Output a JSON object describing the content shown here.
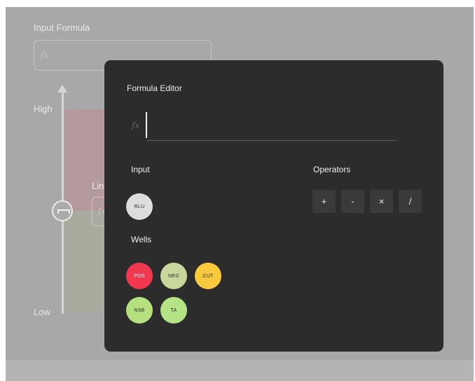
{
  "background": {
    "input_formula_label": "Input Formula",
    "fx_placeholder": "fx",
    "high_label": "High",
    "low_label": "Low",
    "partial_label": "Lin",
    "mini_fx": "fx"
  },
  "modal": {
    "title": "Formula Editor",
    "fx_label": "fx",
    "formula_value": "",
    "input_section_label": "Input",
    "operators_section_label": "Operators",
    "wells_section_label": "Wells",
    "inputs": [
      {
        "label": "RLU",
        "color": "#dddddd"
      }
    ],
    "operators": [
      "+",
      "-",
      "×",
      "/"
    ],
    "wells": [
      {
        "label": "POS",
        "color": "#f2384f"
      },
      {
        "label": "NEG",
        "color": "#c8d79b"
      },
      {
        "label": "CUT",
        "color": "#f8c93c"
      },
      {
        "label": "NSB",
        "color": "#b4e07f"
      },
      {
        "label": "TA",
        "color": "#b4e486"
      }
    ]
  }
}
